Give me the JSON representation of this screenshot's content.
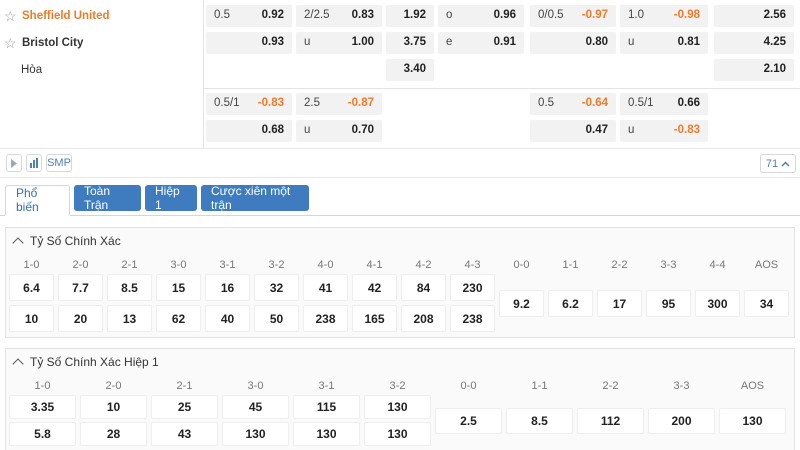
{
  "teams": {
    "home": "Sheffield United",
    "away": "Bristol City",
    "draw": "Hòa"
  },
  "odds": {
    "row1": [
      {
        "label": "0.5",
        "value": "0.92"
      },
      {
        "label": "2/2.5",
        "value": "0.83"
      },
      {
        "value": "1.92"
      },
      {
        "label": "o",
        "value": "0.96"
      },
      {
        "label": "0/0.5",
        "value": "-0.97"
      },
      {
        "label": "1.0",
        "value": "-0.98"
      },
      {
        "value": "2.56"
      }
    ],
    "row2": [
      {
        "value": "0.93"
      },
      {
        "label": "u",
        "value": "1.00"
      },
      {
        "value": "3.75"
      },
      {
        "label": "e",
        "value": "0.91"
      },
      {
        "value": "0.80"
      },
      {
        "label": "u",
        "value": "0.81"
      },
      {
        "value": "4.25"
      }
    ],
    "row3": [
      {
        "value": "3.40"
      },
      {
        "value": "2.10"
      }
    ],
    "row4": [
      {
        "label": "0.5/1",
        "value": "-0.83"
      },
      {
        "label": "2.5",
        "value": "-0.87"
      },
      {
        "label": "0.5",
        "value": "-0.64"
      },
      {
        "label": "0.5/1",
        "value": "0.66"
      }
    ],
    "row5": [
      {
        "value": "0.68"
      },
      {
        "label": "u",
        "value": "0.70"
      },
      {
        "value": "0.47"
      },
      {
        "label": "u",
        "value": "-0.83"
      }
    ]
  },
  "toolbar": {
    "smp_label": "SMP",
    "count": "71"
  },
  "tabs": [
    "Phổ biến",
    "Toàn Trận",
    "Hiệp 1",
    "Cược xiên một trận"
  ],
  "correct_score": {
    "title": "Tỷ Số Chính Xác",
    "home_headers": [
      "1-0",
      "2-0",
      "2-1",
      "3-0",
      "3-1",
      "3-2",
      "4-0",
      "4-1",
      "4-2",
      "4-3"
    ],
    "home_row1": [
      "6.4",
      "7.7",
      "8.5",
      "15",
      "16",
      "32",
      "41",
      "42",
      "84",
      "230"
    ],
    "home_row2": [
      "10",
      "20",
      "13",
      "62",
      "40",
      "50",
      "238",
      "165",
      "208",
      "238"
    ],
    "draw_headers": [
      "0-0",
      "1-1",
      "2-2",
      "3-3",
      "4-4",
      "AOS"
    ],
    "draw_values": [
      "9.2",
      "6.2",
      "17",
      "95",
      "300",
      "34"
    ]
  },
  "correct_score_ht": {
    "title": "Tỷ Số Chính Xác Hiệp 1",
    "home_headers": [
      "1-0",
      "2-0",
      "2-1",
      "3-0",
      "3-1",
      "3-2"
    ],
    "home_row1": [
      "3.35",
      "10",
      "25",
      "45",
      "115",
      "130"
    ],
    "home_row2": [
      "5.8",
      "28",
      "43",
      "130",
      "130",
      "130"
    ],
    "draw_headers": [
      "0-0",
      "1-1",
      "2-2",
      "3-3",
      "AOS"
    ],
    "draw_values": [
      "2.5",
      "8.5",
      "112",
      "200",
      "130"
    ]
  },
  "colors": {
    "accent_orange": "#f07a28",
    "tab_blue": "#3e7cbf",
    "link_blue": "#4d7fb8"
  }
}
